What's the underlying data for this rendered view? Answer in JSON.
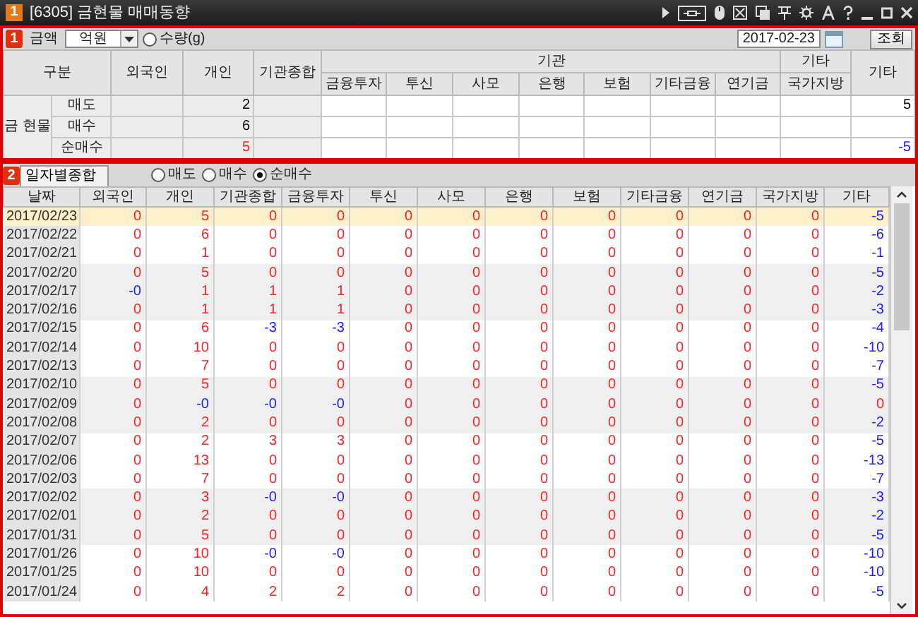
{
  "window": {
    "badge": "1",
    "title": "[6305] 금현물 매매동향"
  },
  "filter_panel": {
    "badge": "1",
    "amount_label": "금액",
    "unit_select": {
      "value": "억원"
    },
    "quantity_radio": {
      "label": "수량(g)",
      "selected": false
    },
    "date_field": {
      "value": "2017-02-23"
    },
    "search_button": "조회"
  },
  "summary_table": {
    "category_label": "구분",
    "group_label": "금 현물",
    "header": [
      {
        "label": "외국인"
      },
      {
        "label": "개인"
      },
      {
        "label": "기관종합"
      },
      {
        "label": "기관",
        "children": [
          {
            "label": "금융투자"
          },
          {
            "label": "투신"
          },
          {
            "label": "사모"
          },
          {
            "label": "은행"
          },
          {
            "label": "보험"
          },
          {
            "label": "기타금융"
          },
          {
            "label": "연기금"
          }
        ]
      },
      {
        "label": "기타",
        "children": [
          {
            "label": "국가지방"
          }
        ]
      },
      {
        "label": "기타"
      }
    ],
    "rows": [
      {
        "label": "매도",
        "cells": [
          null,
          {
            "value": "2",
            "color": "#000000"
          },
          null,
          null,
          null,
          null,
          null,
          null,
          null,
          null,
          null,
          {
            "value": "5",
            "color": "#000000"
          }
        ]
      },
      {
        "label": "매수",
        "cells": [
          null,
          {
            "value": "6",
            "color": "#000000"
          },
          null,
          null,
          null,
          null,
          null,
          null,
          null,
          null,
          null,
          null
        ]
      },
      {
        "label": "순매수",
        "cells": [
          null,
          {
            "value": "5",
            "color": "#ff2020"
          },
          null,
          null,
          null,
          null,
          null,
          null,
          null,
          null,
          null,
          {
            "value": "-5",
            "color": "#2020ff"
          }
        ]
      }
    ]
  },
  "detail_panel": {
    "badge": "2",
    "tabs": [
      {
        "label": "일자별종합",
        "selected": true
      }
    ],
    "view_options": [
      {
        "label": "매도",
        "selected": false
      },
      {
        "label": "매수",
        "selected": false
      },
      {
        "label": "순매수",
        "selected": true
      }
    ],
    "table": {
      "columns": [
        "날짜",
        "외국인",
        "개인",
        "기관종합",
        "금융투자",
        "투신",
        "사모",
        "은행",
        "보험",
        "기타금융",
        "연기금",
        "국가지방",
        "기타"
      ],
      "rows": [
        {
          "selected": true,
          "cells": [
            {
              "value": "2017/02/23"
            },
            {
              "value": "0",
              "color": "#ff2020"
            },
            {
              "value": "5",
              "color": "#ff2020"
            },
            {
              "value": "0",
              "color": "#ff2020"
            },
            {
              "value": "0",
              "color": "#ff2020"
            },
            {
              "value": "0",
              "color": "#ff2020"
            },
            {
              "value": "0",
              "color": "#ff2020"
            },
            {
              "value": "0",
              "color": "#ff2020"
            },
            {
              "value": "0",
              "color": "#ff2020"
            },
            {
              "value": "0",
              "color": "#ff2020"
            },
            {
              "value": "0",
              "color": "#ff2020"
            },
            {
              "value": "0",
              "color": "#ff2020"
            },
            {
              "value": "-5",
              "color": "#2020ff"
            }
          ]
        },
        {
          "selected": false,
          "cells": [
            {
              "value": "2017/02/22"
            },
            {
              "value": "0",
              "color": "#ff2020"
            },
            {
              "value": "6",
              "color": "#ff2020"
            },
            {
              "value": "0",
              "color": "#ff2020"
            },
            {
              "value": "0",
              "color": "#ff2020"
            },
            {
              "value": "0",
              "color": "#ff2020"
            },
            {
              "value": "0",
              "color": "#ff2020"
            },
            {
              "value": "0",
              "color": "#ff2020"
            },
            {
              "value": "0",
              "color": "#ff2020"
            },
            {
              "value": "0",
              "color": "#ff2020"
            },
            {
              "value": "0",
              "color": "#ff2020"
            },
            {
              "value": "0",
              "color": "#ff2020"
            },
            {
              "value": "-6",
              "color": "#2020ff"
            }
          ]
        },
        {
          "selected": false,
          "cells": [
            {
              "value": "2017/02/21"
            },
            {
              "value": "0",
              "color": "#ff2020"
            },
            {
              "value": "1",
              "color": "#ff2020"
            },
            {
              "value": "0",
              "color": "#ff2020"
            },
            {
              "value": "0",
              "color": "#ff2020"
            },
            {
              "value": "0",
              "color": "#ff2020"
            },
            {
              "value": "0",
              "color": "#ff2020"
            },
            {
              "value": "0",
              "color": "#ff2020"
            },
            {
              "value": "0",
              "color": "#ff2020"
            },
            {
              "value": "0",
              "color": "#ff2020"
            },
            {
              "value": "0",
              "color": "#ff2020"
            },
            {
              "value": "0",
              "color": "#ff2020"
            },
            {
              "value": "-1",
              "color": "#2020ff"
            }
          ]
        },
        {
          "selected": false,
          "cells": [
            {
              "value": "2017/02/20"
            },
            {
              "value": "0",
              "color": "#ff2020"
            },
            {
              "value": "5",
              "color": "#ff2020"
            },
            {
              "value": "0",
              "color": "#ff2020"
            },
            {
              "value": "0",
              "color": "#ff2020"
            },
            {
              "value": "0",
              "color": "#ff2020"
            },
            {
              "value": "0",
              "color": "#ff2020"
            },
            {
              "value": "0",
              "color": "#ff2020"
            },
            {
              "value": "0",
              "color": "#ff2020"
            },
            {
              "value": "0",
              "color": "#ff2020"
            },
            {
              "value": "0",
              "color": "#ff2020"
            },
            {
              "value": "0",
              "color": "#ff2020"
            },
            {
              "value": "-5",
              "color": "#2020ff"
            }
          ]
        },
        {
          "selected": false,
          "cells": [
            {
              "value": "2017/02/17"
            },
            {
              "value": "-0",
              "color": "#2020ff"
            },
            {
              "value": "1",
              "color": "#ff2020"
            },
            {
              "value": "1",
              "color": "#ff2020"
            },
            {
              "value": "1",
              "color": "#ff2020"
            },
            {
              "value": "0",
              "color": "#ff2020"
            },
            {
              "value": "0",
              "color": "#ff2020"
            },
            {
              "value": "0",
              "color": "#ff2020"
            },
            {
              "value": "0",
              "color": "#ff2020"
            },
            {
              "value": "0",
              "color": "#ff2020"
            },
            {
              "value": "0",
              "color": "#ff2020"
            },
            {
              "value": "0",
              "color": "#ff2020"
            },
            {
              "value": "-2",
              "color": "#2020ff"
            }
          ]
        },
        {
          "selected": false,
          "cells": [
            {
              "value": "2017/02/16"
            },
            {
              "value": "0",
              "color": "#ff2020"
            },
            {
              "value": "1",
              "color": "#ff2020"
            },
            {
              "value": "1",
              "color": "#ff2020"
            },
            {
              "value": "1",
              "color": "#ff2020"
            },
            {
              "value": "0",
              "color": "#ff2020"
            },
            {
              "value": "0",
              "color": "#ff2020"
            },
            {
              "value": "0",
              "color": "#ff2020"
            },
            {
              "value": "0",
              "color": "#ff2020"
            },
            {
              "value": "0",
              "color": "#ff2020"
            },
            {
              "value": "0",
              "color": "#ff2020"
            },
            {
              "value": "0",
              "color": "#ff2020"
            },
            {
              "value": "-3",
              "color": "#2020ff"
            }
          ]
        },
        {
          "selected": false,
          "cells": [
            {
              "value": "2017/02/15"
            },
            {
              "value": "0",
              "color": "#ff2020"
            },
            {
              "value": "6",
              "color": "#ff2020"
            },
            {
              "value": "-3",
              "color": "#2020ff"
            },
            {
              "value": "-3",
              "color": "#2020ff"
            },
            {
              "value": "0",
              "color": "#ff2020"
            },
            {
              "value": "0",
              "color": "#ff2020"
            },
            {
              "value": "0",
              "color": "#ff2020"
            },
            {
              "value": "0",
              "color": "#ff2020"
            },
            {
              "value": "0",
              "color": "#ff2020"
            },
            {
              "value": "0",
              "color": "#ff2020"
            },
            {
              "value": "0",
              "color": "#ff2020"
            },
            {
              "value": "-4",
              "color": "#2020ff"
            }
          ]
        },
        {
          "selected": false,
          "cells": [
            {
              "value": "2017/02/14"
            },
            {
              "value": "0",
              "color": "#ff2020"
            },
            {
              "value": "10",
              "color": "#ff2020"
            },
            {
              "value": "0",
              "color": "#ff2020"
            },
            {
              "value": "0",
              "color": "#ff2020"
            },
            {
              "value": "0",
              "color": "#ff2020"
            },
            {
              "value": "0",
              "color": "#ff2020"
            },
            {
              "value": "0",
              "color": "#ff2020"
            },
            {
              "value": "0",
              "color": "#ff2020"
            },
            {
              "value": "0",
              "color": "#ff2020"
            },
            {
              "value": "0",
              "color": "#ff2020"
            },
            {
              "value": "0",
              "color": "#ff2020"
            },
            {
              "value": "-10",
              "color": "#2020ff"
            }
          ]
        },
        {
          "selected": false,
          "cells": [
            {
              "value": "2017/02/13"
            },
            {
              "value": "0",
              "color": "#ff2020"
            },
            {
              "value": "7",
              "color": "#ff2020"
            },
            {
              "value": "0",
              "color": "#ff2020"
            },
            {
              "value": "0",
              "color": "#ff2020"
            },
            {
              "value": "0",
              "color": "#ff2020"
            },
            {
              "value": "0",
              "color": "#ff2020"
            },
            {
              "value": "0",
              "color": "#ff2020"
            },
            {
              "value": "0",
              "color": "#ff2020"
            },
            {
              "value": "0",
              "color": "#ff2020"
            },
            {
              "value": "0",
              "color": "#ff2020"
            },
            {
              "value": "0",
              "color": "#ff2020"
            },
            {
              "value": "-7",
              "color": "#2020ff"
            }
          ]
        },
        {
          "selected": false,
          "cells": [
            {
              "value": "2017/02/10"
            },
            {
              "value": "0",
              "color": "#ff2020"
            },
            {
              "value": "5",
              "color": "#ff2020"
            },
            {
              "value": "0",
              "color": "#ff2020"
            },
            {
              "value": "0",
              "color": "#ff2020"
            },
            {
              "value": "0",
              "color": "#ff2020"
            },
            {
              "value": "0",
              "color": "#ff2020"
            },
            {
              "value": "0",
              "color": "#ff2020"
            },
            {
              "value": "0",
              "color": "#ff2020"
            },
            {
              "value": "0",
              "color": "#ff2020"
            },
            {
              "value": "0",
              "color": "#ff2020"
            },
            {
              "value": "0",
              "color": "#ff2020"
            },
            {
              "value": "-5",
              "color": "#2020ff"
            }
          ]
        },
        {
          "selected": false,
          "cells": [
            {
              "value": "2017/02/09"
            },
            {
              "value": "0",
              "color": "#ff2020"
            },
            {
              "value": "-0",
              "color": "#2020ff"
            },
            {
              "value": "-0",
              "color": "#2020ff"
            },
            {
              "value": "-0",
              "color": "#2020ff"
            },
            {
              "value": "0",
              "color": "#ff2020"
            },
            {
              "value": "0",
              "color": "#ff2020"
            },
            {
              "value": "0",
              "color": "#ff2020"
            },
            {
              "value": "0",
              "color": "#ff2020"
            },
            {
              "value": "0",
              "color": "#ff2020"
            },
            {
              "value": "0",
              "color": "#ff2020"
            },
            {
              "value": "0",
              "color": "#ff2020"
            },
            {
              "value": "0",
              "color": "#ff2020"
            }
          ]
        },
        {
          "selected": false,
          "cells": [
            {
              "value": "2017/02/08"
            },
            {
              "value": "0",
              "color": "#ff2020"
            },
            {
              "value": "2",
              "color": "#ff2020"
            },
            {
              "value": "0",
              "color": "#ff2020"
            },
            {
              "value": "0",
              "color": "#ff2020"
            },
            {
              "value": "0",
              "color": "#ff2020"
            },
            {
              "value": "0",
              "color": "#ff2020"
            },
            {
              "value": "0",
              "color": "#ff2020"
            },
            {
              "value": "0",
              "color": "#ff2020"
            },
            {
              "value": "0",
              "color": "#ff2020"
            },
            {
              "value": "0",
              "color": "#ff2020"
            },
            {
              "value": "0",
              "color": "#ff2020"
            },
            {
              "value": "-2",
              "color": "#2020ff"
            }
          ]
        },
        {
          "selected": false,
          "cells": [
            {
              "value": "2017/02/07"
            },
            {
              "value": "0",
              "color": "#ff2020"
            },
            {
              "value": "2",
              "color": "#ff2020"
            },
            {
              "value": "3",
              "color": "#ff2020"
            },
            {
              "value": "3",
              "color": "#ff2020"
            },
            {
              "value": "0",
              "color": "#ff2020"
            },
            {
              "value": "0",
              "color": "#ff2020"
            },
            {
              "value": "0",
              "color": "#ff2020"
            },
            {
              "value": "0",
              "color": "#ff2020"
            },
            {
              "value": "0",
              "color": "#ff2020"
            },
            {
              "value": "0",
              "color": "#ff2020"
            },
            {
              "value": "0",
              "color": "#ff2020"
            },
            {
              "value": "-5",
              "color": "#2020ff"
            }
          ]
        },
        {
          "selected": false,
          "cells": [
            {
              "value": "2017/02/06"
            },
            {
              "value": "0",
              "color": "#ff2020"
            },
            {
              "value": "13",
              "color": "#ff2020"
            },
            {
              "value": "0",
              "color": "#ff2020"
            },
            {
              "value": "0",
              "color": "#ff2020"
            },
            {
              "value": "0",
              "color": "#ff2020"
            },
            {
              "value": "0",
              "color": "#ff2020"
            },
            {
              "value": "0",
              "color": "#ff2020"
            },
            {
              "value": "0",
              "color": "#ff2020"
            },
            {
              "value": "0",
              "color": "#ff2020"
            },
            {
              "value": "0",
              "color": "#ff2020"
            },
            {
              "value": "0",
              "color": "#ff2020"
            },
            {
              "value": "-13",
              "color": "#2020ff"
            }
          ]
        },
        {
          "selected": false,
          "cells": [
            {
              "value": "2017/02/03"
            },
            {
              "value": "0",
              "color": "#ff2020"
            },
            {
              "value": "7",
              "color": "#ff2020"
            },
            {
              "value": "0",
              "color": "#ff2020"
            },
            {
              "value": "0",
              "color": "#ff2020"
            },
            {
              "value": "0",
              "color": "#ff2020"
            },
            {
              "value": "0",
              "color": "#ff2020"
            },
            {
              "value": "0",
              "color": "#ff2020"
            },
            {
              "value": "0",
              "color": "#ff2020"
            },
            {
              "value": "0",
              "color": "#ff2020"
            },
            {
              "value": "0",
              "color": "#ff2020"
            },
            {
              "value": "0",
              "color": "#ff2020"
            },
            {
              "value": "-7",
              "color": "#2020ff"
            }
          ]
        },
        {
          "selected": false,
          "cells": [
            {
              "value": "2017/02/02"
            },
            {
              "value": "0",
              "color": "#ff2020"
            },
            {
              "value": "3",
              "color": "#ff2020"
            },
            {
              "value": "-0",
              "color": "#2020ff"
            },
            {
              "value": "-0",
              "color": "#2020ff"
            },
            {
              "value": "0",
              "color": "#ff2020"
            },
            {
              "value": "0",
              "color": "#ff2020"
            },
            {
              "value": "0",
              "color": "#ff2020"
            },
            {
              "value": "0",
              "color": "#ff2020"
            },
            {
              "value": "0",
              "color": "#ff2020"
            },
            {
              "value": "0",
              "color": "#ff2020"
            },
            {
              "value": "0",
              "color": "#ff2020"
            },
            {
              "value": "-3",
              "color": "#2020ff"
            }
          ]
        },
        {
          "selected": false,
          "cells": [
            {
              "value": "2017/02/01"
            },
            {
              "value": "0",
              "color": "#ff2020"
            },
            {
              "value": "2",
              "color": "#ff2020"
            },
            {
              "value": "0",
              "color": "#ff2020"
            },
            {
              "value": "0",
              "color": "#ff2020"
            },
            {
              "value": "0",
              "color": "#ff2020"
            },
            {
              "value": "0",
              "color": "#ff2020"
            },
            {
              "value": "0",
              "color": "#ff2020"
            },
            {
              "value": "0",
              "color": "#ff2020"
            },
            {
              "value": "0",
              "color": "#ff2020"
            },
            {
              "value": "0",
              "color": "#ff2020"
            },
            {
              "value": "0",
              "color": "#ff2020"
            },
            {
              "value": "-2",
              "color": "#2020ff"
            }
          ]
        },
        {
          "selected": false,
          "cells": [
            {
              "value": "2017/01/31"
            },
            {
              "value": "0",
              "color": "#ff2020"
            },
            {
              "value": "5",
              "color": "#ff2020"
            },
            {
              "value": "0",
              "color": "#ff2020"
            },
            {
              "value": "0",
              "color": "#ff2020"
            },
            {
              "value": "0",
              "color": "#ff2020"
            },
            {
              "value": "0",
              "color": "#ff2020"
            },
            {
              "value": "0",
              "color": "#ff2020"
            },
            {
              "value": "0",
              "color": "#ff2020"
            },
            {
              "value": "0",
              "color": "#ff2020"
            },
            {
              "value": "0",
              "color": "#ff2020"
            },
            {
              "value": "0",
              "color": "#ff2020"
            },
            {
              "value": "-5",
              "color": "#2020ff"
            }
          ]
        },
        {
          "selected": false,
          "cells": [
            {
              "value": "2017/01/26"
            },
            {
              "value": "0",
              "color": "#ff2020"
            },
            {
              "value": "10",
              "color": "#ff2020"
            },
            {
              "value": "-0",
              "color": "#2020ff"
            },
            {
              "value": "-0",
              "color": "#2020ff"
            },
            {
              "value": "0",
              "color": "#ff2020"
            },
            {
              "value": "0",
              "color": "#ff2020"
            },
            {
              "value": "0",
              "color": "#ff2020"
            },
            {
              "value": "0",
              "color": "#ff2020"
            },
            {
              "value": "0",
              "color": "#ff2020"
            },
            {
              "value": "0",
              "color": "#ff2020"
            },
            {
              "value": "0",
              "color": "#ff2020"
            },
            {
              "value": "-10",
              "color": "#2020ff"
            }
          ]
        },
        {
          "selected": false,
          "cells": [
            {
              "value": "2017/01/25"
            },
            {
              "value": "0",
              "color": "#ff2020"
            },
            {
              "value": "10",
              "color": "#ff2020"
            },
            {
              "value": "0",
              "color": "#ff2020"
            },
            {
              "value": "0",
              "color": "#ff2020"
            },
            {
              "value": "0",
              "color": "#ff2020"
            },
            {
              "value": "0",
              "color": "#ff2020"
            },
            {
              "value": "0",
              "color": "#ff2020"
            },
            {
              "value": "0",
              "color": "#ff2020"
            },
            {
              "value": "0",
              "color": "#ff2020"
            },
            {
              "value": "0",
              "color": "#ff2020"
            },
            {
              "value": "0",
              "color": "#ff2020"
            },
            {
              "value": "-10",
              "color": "#2020ff"
            }
          ]
        },
        {
          "selected": false,
          "cells": [
            {
              "value": "2017/01/24"
            },
            {
              "value": "0",
              "color": "#ff2020"
            },
            {
              "value": "4",
              "color": "#ff2020"
            },
            {
              "value": "2",
              "color": "#ff2020"
            },
            {
              "value": "2",
              "color": "#ff2020"
            },
            {
              "value": "0",
              "color": "#ff2020"
            },
            {
              "value": "0",
              "color": "#ff2020"
            },
            {
              "value": "0",
              "color": "#ff2020"
            },
            {
              "value": "0",
              "color": "#ff2020"
            },
            {
              "value": "0",
              "color": "#ff2020"
            },
            {
              "value": "0",
              "color": "#ff2020"
            },
            {
              "value": "0",
              "color": "#ff2020"
            },
            {
              "value": "-5",
              "color": "#2020ff"
            }
          ]
        }
      ]
    }
  }
}
